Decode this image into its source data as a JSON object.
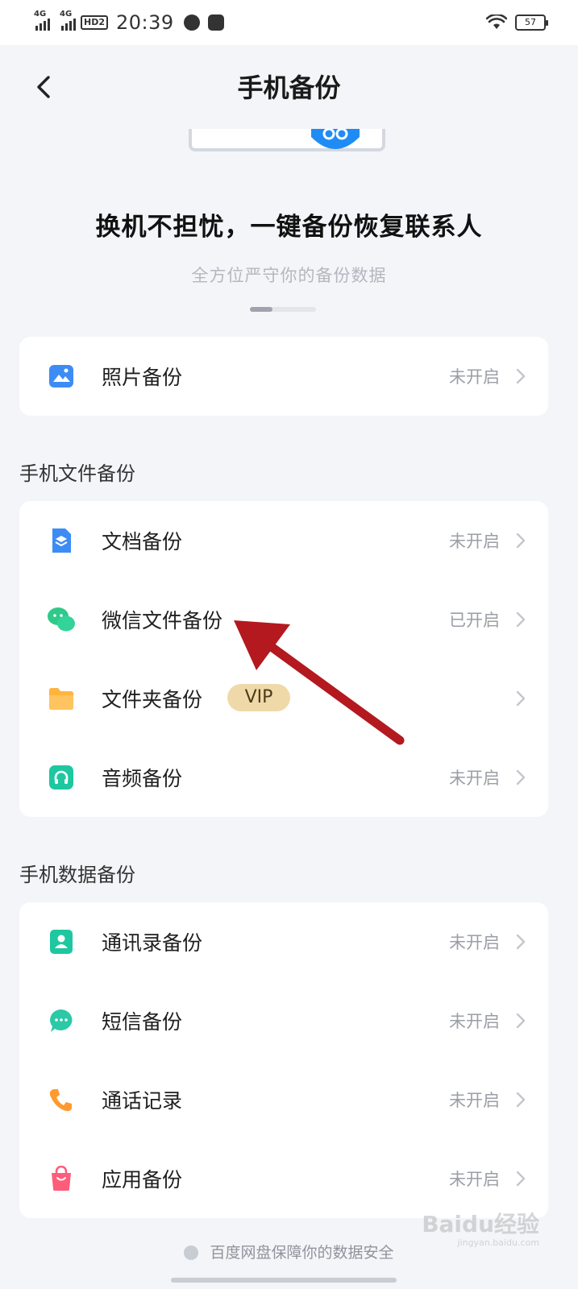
{
  "status_bar": {
    "network_1": "4G",
    "network_2": "4G",
    "hd": "HD2",
    "time": "20:39",
    "battery": "57"
  },
  "nav": {
    "title": "手机备份",
    "back_icon": "chevron-left-icon"
  },
  "hero": {
    "title": "换机不担忧，一键备份恢复联系人",
    "subtitle": "全方位严守你的备份数据"
  },
  "photo_card": {
    "items": [
      {
        "label": "照片备份",
        "status": "未开启",
        "icon": "photo-icon",
        "color": "#3d8cf5"
      }
    ]
  },
  "file_section": {
    "title": "手机文件备份",
    "items": [
      {
        "label": "文档备份",
        "status": "未开启",
        "icon": "document-icon",
        "color": "#3d8cf5"
      },
      {
        "label": "微信文件备份",
        "status": "已开启",
        "icon": "wechat-icon",
        "color": "#2fc98a"
      },
      {
        "label": "文件夹备份",
        "badge": "VIP",
        "status": "",
        "icon": "folder-icon",
        "color": "#ffaa2b"
      },
      {
        "label": "音频备份",
        "status": "未开启",
        "icon": "headphones-icon",
        "color": "#1fc7a0"
      }
    ]
  },
  "data_section": {
    "title": "手机数据备份",
    "items": [
      {
        "label": "通讯录备份",
        "status": "未开启",
        "icon": "contacts-icon",
        "color": "#1fc7a0"
      },
      {
        "label": "短信备份",
        "status": "未开启",
        "icon": "message-icon",
        "color": "#2bc9a6"
      },
      {
        "label": "通话记录",
        "status": "未开启",
        "icon": "phone-icon",
        "color": "#ff9a2e"
      },
      {
        "label": "应用备份",
        "status": "未开启",
        "icon": "app-bag-icon",
        "color": "#ff5c7a"
      }
    ]
  },
  "footer": {
    "text": "百度网盘保障你的数据安全"
  },
  "watermark": {
    "brand": "Baidu经验",
    "url": "jingyan.baidu.com"
  }
}
